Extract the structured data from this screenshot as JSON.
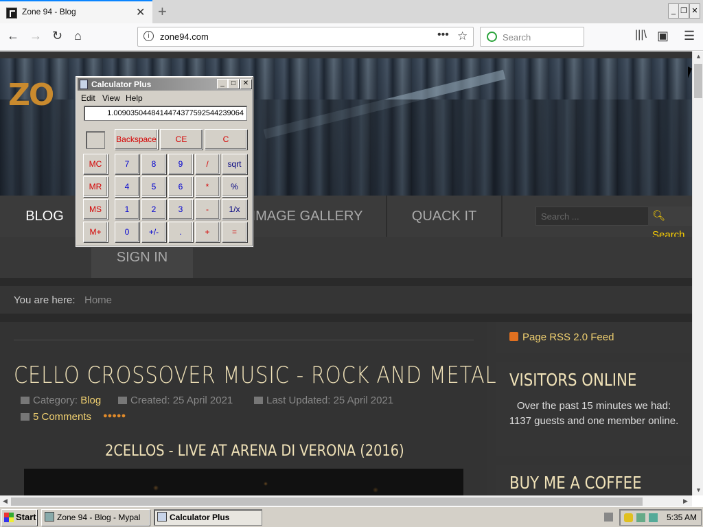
{
  "browser": {
    "tab_title": "Zone 94 - Blog",
    "new_tab_symbol": "+",
    "url": "zone94.com",
    "search_placeholder": "Search",
    "url_dots": "•••",
    "window_buttons": [
      "_",
      "❐",
      "✕"
    ]
  },
  "site": {
    "logo_text": "ZO",
    "nav": [
      "BLOG",
      "IMAGE GALLERY",
      "QUACK IT"
    ],
    "signin": "SIGN IN",
    "search_placeholder": "Search ...",
    "search_button": "Search",
    "breadcrumb_label": "You are here:",
    "breadcrumb_home": "Home",
    "article": {
      "title": "CELLO CROSSOVER MUSIC - ROCK AND METAL",
      "category_label": "Category:",
      "category": "Blog",
      "created": "Created: 25 April 2021",
      "updated": "Last Updated: 25 April 2021",
      "comments": "5 Comments",
      "rating": "●●●●●",
      "video_title": "2CELLOS - LIVE AT ARENA DI VERONA (2016)"
    },
    "sidebar": {
      "rss": "Page RSS 2.0 Feed",
      "visitors_title": "VISITORS ONLINE",
      "visitors_text": "Over the past 15 minutes we had: 1137 guests and one member online.",
      "coffee_title": "BUY ME A COFFEE"
    }
  },
  "calculator": {
    "title": "Calculator Plus",
    "menu": [
      "Edit",
      "View",
      "Help"
    ],
    "display": "1.0090350448414474377592544239064",
    "buttons": {
      "backspace": "Backspace",
      "ce": "CE",
      "c": "C",
      "mc": "MC",
      "mr": "MR",
      "ms": "MS",
      "mplus": "M+",
      "k7": "7",
      "k8": "8",
      "k9": "9",
      "div": "/",
      "sqrt": "sqrt",
      "k4": "4",
      "k5": "5",
      "k6": "6",
      "mul": "*",
      "pct": "%",
      "k1": "1",
      "k2": "2",
      "k3": "3",
      "sub": "-",
      "inv": "1/x",
      "k0": "0",
      "neg": "+/-",
      "dot": ".",
      "add": "+",
      "eq": "="
    }
  },
  "taskbar": {
    "start": "Start",
    "tasks": [
      "Zone 94 - Blog - Mypal",
      "Calculator Plus"
    ],
    "time": "5:35 AM"
  }
}
